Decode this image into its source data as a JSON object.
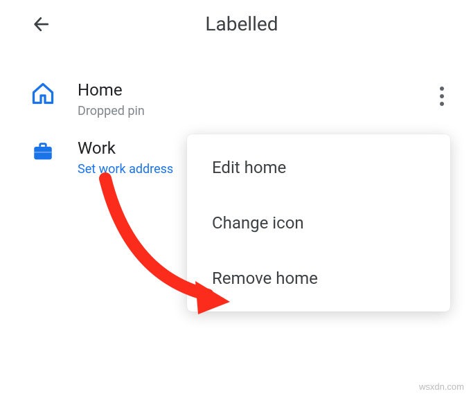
{
  "header": {
    "title": "Labelled"
  },
  "items": [
    {
      "title": "Home",
      "subtitle": "Dropped pin",
      "isLink": false
    },
    {
      "title": "Work",
      "subtitle": "Set work address",
      "isLink": true
    }
  ],
  "menu": {
    "items": [
      "Edit home",
      "Change icon",
      "Remove home"
    ]
  },
  "watermark": "wsxdn.com",
  "colors": {
    "accent": "#1a73e8",
    "arrow": "#fb2c1c"
  }
}
